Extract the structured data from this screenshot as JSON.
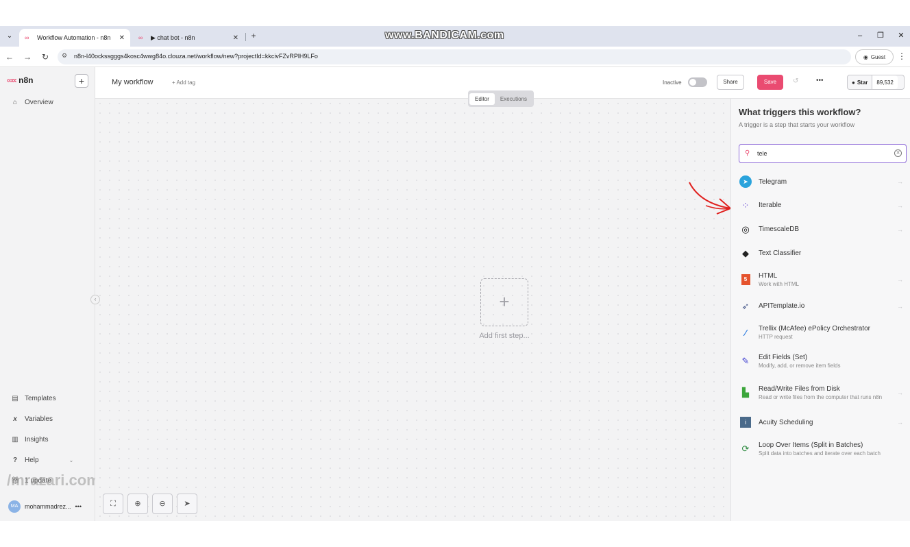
{
  "browser": {
    "tabs": [
      {
        "title": "Workflow Automation - n8n",
        "active": true
      },
      {
        "title": "▶ chat bot - n8n",
        "active": false
      }
    ],
    "watermark": "www.BANDICAM.com",
    "url": "n8n-l40ockssgggs4kosc4wwg84o.clouza.net/workflow/new?projectId=kkcivFZvRPlH9LFo",
    "profile_label": "Guest"
  },
  "sidebar": {
    "brand": "n8n",
    "add_label": "+",
    "top_items": [
      {
        "label": "Overview",
        "icon": "home-icon"
      }
    ],
    "bottom_items": [
      {
        "label": "Templates",
        "icon": "templates-icon"
      },
      {
        "label": "Variables",
        "icon": "variables-icon"
      },
      {
        "label": "Insights",
        "icon": "insights-icon"
      },
      {
        "label": "Help",
        "icon": "help-icon"
      }
    ],
    "update_label": "1 update",
    "watermark": "/mrazari.com",
    "user": {
      "initials": "MA",
      "name": "mohammadrez..."
    }
  },
  "header": {
    "workflow_name": "My workflow",
    "add_tag": "+ Add tag",
    "status_label": "Inactive",
    "share_label": "Share",
    "save_label": "Save",
    "github": {
      "star_label": "Star",
      "count": "89,532"
    }
  },
  "canvas": {
    "view_tabs": [
      {
        "label": "Editor",
        "active": true
      },
      {
        "label": "Executions",
        "active": false
      }
    ],
    "add_first_step": "Add first step..."
  },
  "trigger_panel": {
    "title": "What triggers this workflow?",
    "subtitle": "A trigger is a step that starts your workflow",
    "search_value": "tele",
    "results": [
      {
        "name": "Telegram",
        "desc": "",
        "icon": "telegram-icon",
        "arrow": true
      },
      {
        "name": "Iterable",
        "desc": "",
        "icon": "iterable-icon",
        "arrow": true
      },
      {
        "name": "TimescaleDB",
        "desc": "",
        "icon": "timescaledb-icon",
        "arrow": true
      },
      {
        "name": "Text Classifier",
        "desc": "",
        "icon": "tag-icon",
        "arrow": false
      },
      {
        "name": "HTML",
        "desc": "Work with HTML",
        "icon": "html5-icon",
        "arrow": true
      },
      {
        "name": "APITemplate.io",
        "desc": "",
        "icon": "apitemplate-icon",
        "arrow": true
      },
      {
        "name": "Trellix (McAfee) ePolicy Orchestrator",
        "desc": "HTTP request",
        "icon": "trellix-icon",
        "arrow": false
      },
      {
        "name": "Edit Fields (Set)",
        "desc": "Modify, add, or remove item fields",
        "icon": "pencil-icon",
        "arrow": false
      },
      {
        "name": "Read/Write Files from Disk",
        "desc": "Read or write files from the computer that runs n8n",
        "icon": "file-icon",
        "arrow": true
      },
      {
        "name": "Acuity Scheduling",
        "desc": "",
        "icon": "acuity-icon",
        "arrow": true
      },
      {
        "name": "Loop Over Items (Split in Batches)",
        "desc": "Split data into batches and iterate over each batch",
        "icon": "loop-icon",
        "arrow": false
      }
    ]
  }
}
